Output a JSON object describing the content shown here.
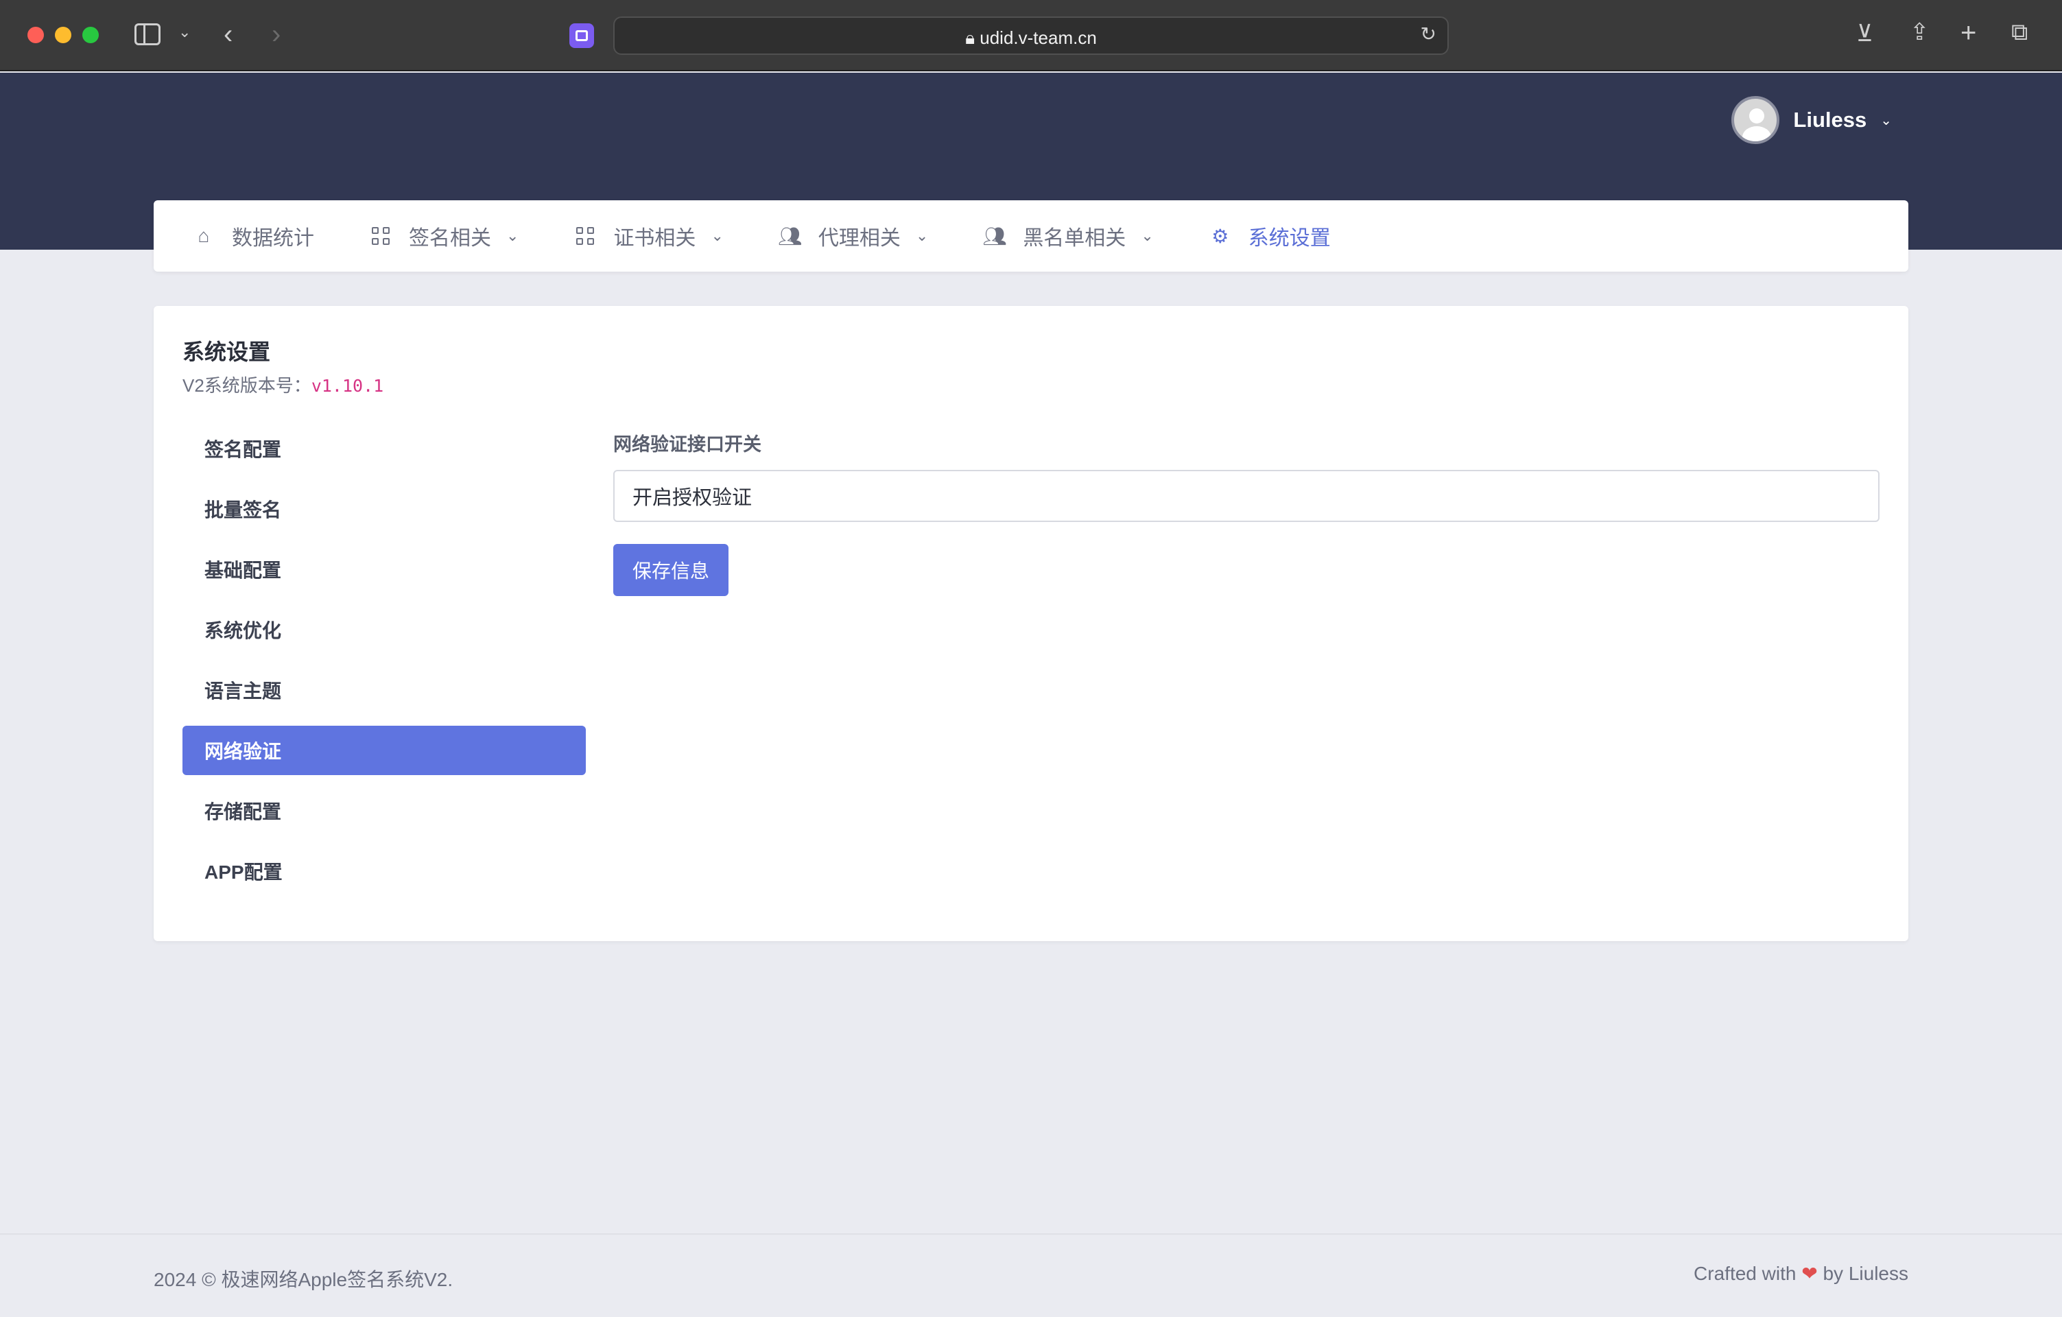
{
  "browser": {
    "url": "udid.v-team.cn"
  },
  "user": {
    "name": "Liuless"
  },
  "nav": {
    "items": [
      {
        "label": "数据统计",
        "icon": "home-icon",
        "dropdown": false
      },
      {
        "label": "签名相关",
        "icon": "grid-icon",
        "dropdown": true
      },
      {
        "label": "证书相关",
        "icon": "grid-icon",
        "dropdown": true
      },
      {
        "label": "代理相关",
        "icon": "users-icon",
        "dropdown": true
      },
      {
        "label": "黑名单相关",
        "icon": "users-icon",
        "dropdown": true
      },
      {
        "label": "系统设置",
        "icon": "gear-icon",
        "dropdown": false,
        "active": true
      }
    ]
  },
  "card": {
    "title": "系统设置",
    "version_label": "V2系统版本号：",
    "version_value": "v1.10.1"
  },
  "side_menu": {
    "items": [
      {
        "label": "签名配置"
      },
      {
        "label": "批量签名"
      },
      {
        "label": "基础配置"
      },
      {
        "label": "系统优化"
      },
      {
        "label": "语言主题"
      },
      {
        "label": "网络验证",
        "active": true
      },
      {
        "label": "存储配置"
      },
      {
        "label": "APP配置"
      }
    ]
  },
  "form": {
    "field_label": "网络验证接口开关",
    "select_value": "开启授权验证",
    "save_label": "保存信息"
  },
  "footer": {
    "left": "2024 © 极速网络Apple签名系统V2.",
    "right_prefix": "Crafted with",
    "right_suffix": "by Liuless"
  },
  "colors": {
    "header_bg": "#313752",
    "accent": "#5f74e0",
    "version_code": "#d63384"
  }
}
